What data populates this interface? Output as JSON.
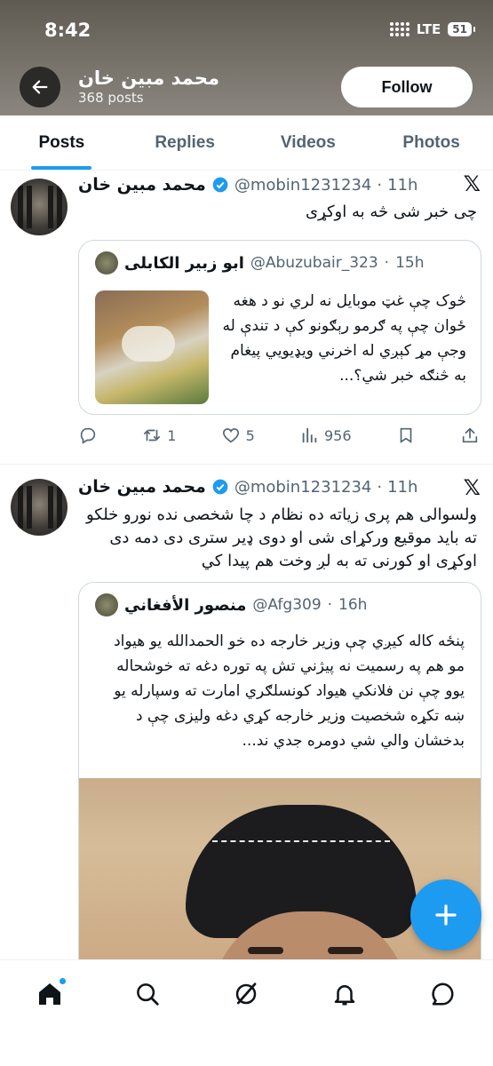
{
  "status_bar": {
    "time": "8:42",
    "network": "LTE",
    "battery": "51"
  },
  "header": {
    "name": "محمد مبین خان",
    "posts_count": "368 posts",
    "follow_label": "Follow"
  },
  "tabs": [
    {
      "label": "Posts",
      "active": true
    },
    {
      "label": "Replies",
      "active": false
    },
    {
      "label": "Videos",
      "active": false
    },
    {
      "label": "Photos",
      "active": false
    }
  ],
  "tweets": [
    {
      "author": "محمد مبین خان",
      "handle": "@mobin1231234",
      "time": "11h",
      "text": "چی خبر شی څه به اوکړی",
      "quote": {
        "author": "ابو زبير الکابلی",
        "handle": "@Abuzubair_323",
        "time": "15h",
        "text": "څوک چې غټ موبايل نه لري نو د هغه ځوان چې په ګرمو رېګونو کې د تندې له وجې مړ کېږي له اخرني ويډيويي پيغام به څنګه خبر شي؟..."
      },
      "stats": {
        "replies": "",
        "reposts": "1",
        "likes": "5",
        "views": "956"
      }
    },
    {
      "author": "محمد مبین خان",
      "handle": "@mobin1231234",
      "time": "11h",
      "text": "ولسوالی هم پری زیاته ده نظام د چا شخصی نده نورو خلکو ته باید موقیع ورکړای شی او دوی ډیر ستری دی دمه دی اوکړی او کورنی ته به لږ وخت هم پیدا کي",
      "quote": {
        "author": "منصور الأفغاني",
        "handle": "@Afg309",
        "time": "16h",
        "text": "پنځه کاله کيږي چې وزير خارجه ده خو الحمدالله يو هيواد مو هم په رسميت نه پيژني تش په توره دغه ته خوشحاله يوو چې نن فلانکي هيواد کونسلګري امارت ته وسپارله يو ښه تکړه شخصيت وزير خارجه کړي دغه وليزی چې د بدخشان والي شي دومره جدي ند..."
      }
    }
  ],
  "colors": {
    "accent": "#1d9bf0",
    "text": "#0f1419",
    "secondary": "#536471",
    "border": "#cfd9de"
  },
  "icons": {
    "back": "arrow-left-icon",
    "x_logo": "x-logo-icon",
    "actions": [
      "reply-icon",
      "repost-icon",
      "like-icon",
      "views-icon",
      "bookmark-icon",
      "share-icon"
    ],
    "nav": [
      "home-icon",
      "search-icon",
      "grok-icon",
      "notifications-icon",
      "messages-icon"
    ],
    "fab": "plus-icon"
  }
}
